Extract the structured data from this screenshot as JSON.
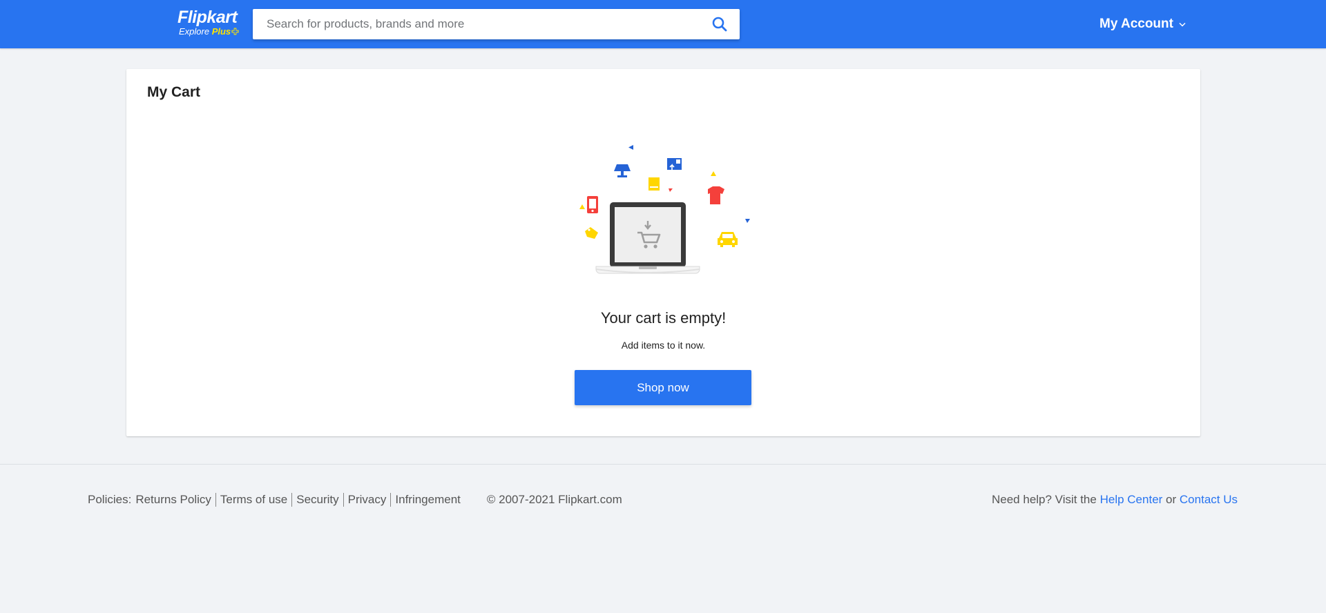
{
  "header": {
    "logo_main": "Flipkart",
    "logo_sub_prefix": "Explore",
    "logo_sub_plus": "Plus",
    "search_placeholder": "Search for products, brands and more",
    "account_label": "My Account"
  },
  "cart": {
    "title": "My Cart",
    "empty_title": "Your cart is empty!",
    "empty_subtitle": "Add items to it now.",
    "shop_button": "Shop now"
  },
  "footer": {
    "policies_label": "Policies:",
    "policies": [
      "Returns Policy",
      "Terms of use",
      "Security",
      "Privacy",
      "Infringement"
    ],
    "copyright": "© 2007-2021 Flipkart.com",
    "help_prefix": "Need help? Visit the",
    "help_center": "Help Center",
    "help_or": "or",
    "contact_us": "Contact Us"
  },
  "colors": {
    "brand_blue": "#2874f0",
    "plus_yellow": "#ffe500",
    "background": "#f1f3f6",
    "illus_red": "#f4403b",
    "illus_yellow": "#ffd600",
    "illus_blue": "#2563d6",
    "laptop_dark": "#3a3a3a"
  }
}
